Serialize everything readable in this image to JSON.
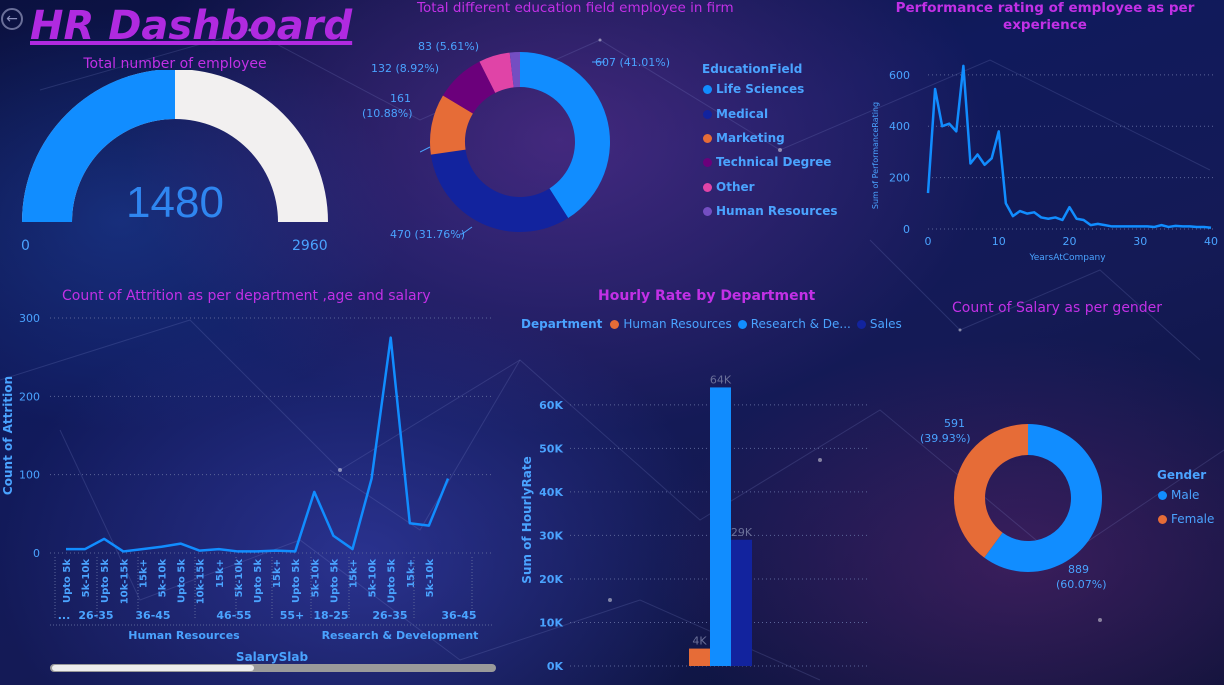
{
  "header": {
    "title": "HR Dashboard"
  },
  "colors": {
    "blue": "#118dff",
    "navy": "#12239e",
    "orange": "#e66c37",
    "purple": "#6b007b",
    "pink": "#e044a7",
    "violet": "#744ec2",
    "title": "#c230e6",
    "tick": "#4aa3ff"
  },
  "gauge": {
    "title": "Total number of employee",
    "value": 1480,
    "value_label": "1480",
    "min_label": "0",
    "max_label": "2960",
    "chart_data": {
      "type": "gauge",
      "value": 1480,
      "min": 0,
      "max": 2960
    }
  },
  "education": {
    "title": "Total different education field employee in firm",
    "legend_title": "EducationField",
    "items": [
      {
        "name": "Life Sciences",
        "label": "607 (41.01%)"
      },
      {
        "name": "Medical",
        "label": "470 (31.76%)"
      },
      {
        "name": "Marketing",
        "label_a": "161",
        "label_b": "(10.88%)"
      },
      {
        "name": "Technical Degree",
        "label": "132 (8.92%)"
      },
      {
        "name": "Other",
        "label": "83 (5.61%)"
      },
      {
        "name": "Human Resources",
        "label": ""
      }
    ],
    "chart_data": {
      "type": "pie",
      "categories": [
        "Life Sciences",
        "Medical",
        "Marketing",
        "Technical Degree",
        "Other",
        "Human Resources"
      ],
      "values": [
        607,
        470,
        161,
        132,
        83,
        27
      ]
    }
  },
  "performance": {
    "title_a": "Performance rating of employee as per",
    "title_b": "experience",
    "xlabel": "YearsAtCompany",
    "ylabel": "Sum of PerformanceRating",
    "y_ticks": [
      "600",
      "400",
      "200",
      "0"
    ],
    "x_ticks": [
      "0",
      "10",
      "20",
      "30",
      "40"
    ],
    "chart_data": {
      "type": "line",
      "xlim": [
        0,
        40
      ],
      "ylim": [
        0,
        650
      ],
      "x": [
        0,
        1,
        2,
        3,
        4,
        5,
        6,
        7,
        8,
        9,
        10,
        11,
        12,
        13,
        14,
        15,
        16,
        17,
        18,
        19,
        20,
        21,
        22,
        23,
        24,
        25,
        26,
        27,
        28,
        29,
        30,
        31,
        32,
        33,
        34,
        35,
        36,
        37,
        38,
        39,
        40
      ],
      "y": [
        140,
        545,
        400,
        410,
        380,
        635,
        255,
        290,
        250,
        275,
        380,
        100,
        50,
        70,
        60,
        65,
        45,
        40,
        45,
        35,
        85,
        40,
        35,
        15,
        20,
        15,
        10,
        10,
        10,
        10,
        10,
        10,
        8,
        15,
        8,
        12,
        10,
        10,
        8,
        8,
        5
      ]
    }
  },
  "attrition": {
    "title": "Count of Attrition as per department ,age and salary",
    "ylabel": "Count of Attrition",
    "xlabel": "SalarySlab",
    "y_ticks": [
      "300",
      "200",
      "100",
      "0"
    ],
    "slabs": [
      "Upto 5k",
      "5k-10k",
      "Upto 5k",
      "10k-15k",
      "15k+",
      "5k-10k",
      "Upto 5k",
      "10k-15k",
      "15k+",
      "5k-10k",
      "Upto 5k",
      "15k+",
      "Upto 5k",
      "5k-10k",
      "Upto 5k",
      "15k+",
      "5k-10k",
      "Upto 5k",
      "15k+",
      "5k-10k"
    ],
    "age_groups": [
      "...",
      "26-35",
      "36-45",
      "46-55",
      "55+",
      "18-25",
      "26-35",
      "36-45"
    ],
    "departments": [
      "Human Resources",
      "Research & Development"
    ],
    "chart_data": {
      "type": "line",
      "ylim": [
        0,
        300
      ],
      "categories": [
        "Upto 5k",
        "5k-10k",
        "Upto 5k",
        "10k-15k",
        "15k+",
        "5k-10k",
        "Upto 5k",
        "10k-15k",
        "15k+",
        "5k-10k",
        "Upto 5k",
        "15k+",
        "Upto 5k",
        "5k-10k",
        "Upto 5k",
        "15k+",
        "5k-10k",
        "Upto 5k",
        "15k+",
        "5k-10k"
      ],
      "values": [
        5,
        5,
        18,
        2,
        5,
        8,
        12,
        3,
        5,
        2,
        2,
        3,
        2,
        78,
        22,
        5,
        95,
        275,
        38,
        35,
        95
      ]
    }
  },
  "hourly": {
    "title": "Hourly Rate by Department",
    "legend_title": "Department",
    "legend": [
      "Human Resources",
      "Research & De...",
      "Sales"
    ],
    "ylabel": "Sum of HourlyRate",
    "y_ticks": [
      "60K",
      "50K",
      "40K",
      "30K",
      "20K",
      "10K",
      "0K"
    ],
    "bar_labels": [
      "4K",
      "64K",
      "29K"
    ],
    "chart_data": {
      "type": "bar",
      "categories": [
        "Human Resources",
        "Research & Development",
        "Sales"
      ],
      "values": [
        4000,
        64000,
        29000
      ],
      "ylim": [
        0,
        68000
      ]
    }
  },
  "salary_gender": {
    "title": "Count of Salary as per gender",
    "legend_title": "Gender",
    "legend": [
      "Male",
      "Female"
    ],
    "female_label_a": "591",
    "female_label_b": "(39.93%)",
    "male_label_a": "889",
    "male_label_b": "(60.07%)",
    "chart_data": {
      "type": "pie",
      "categories": [
        "Male",
        "Female"
      ],
      "values": [
        889,
        591
      ]
    }
  }
}
